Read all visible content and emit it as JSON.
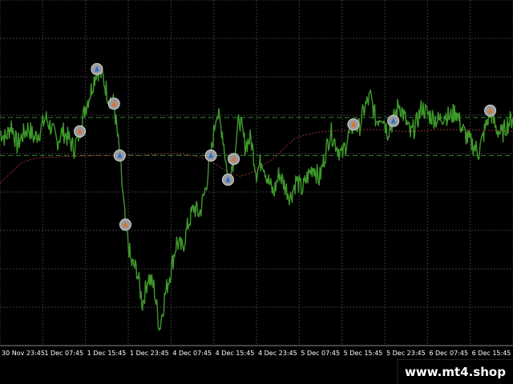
{
  "colors": {
    "background": "#000000",
    "grid": "#3a3a3a",
    "price_line": "#3f9a2b",
    "level_line": "#2f8a2f",
    "moving_average": "#a03030",
    "axis_text": "#ffffff"
  },
  "watermark": "www.mt4.shop",
  "chart_data": {
    "type": "line",
    "grid": true,
    "x_tick_labels": [
      "30 Nov 23:45",
      "1 Dec 07:45",
      "1 Dec 15:45",
      "1 Dec 23:45",
      "4 Dec 07:45",
      "4 Dec 15:45",
      "4 Dec 23:45",
      "5 Dec 07:45",
      "5 Dec 15:45",
      "5 Dec 23:45",
      "6 Dec 07:45",
      "6 Dec 15:45",
      "6 Dec"
    ],
    "series": [
      {
        "values": [
          0.62,
          0.6,
          0.64,
          0.58,
          0.61,
          0.63,
          0.6,
          0.62,
          0.66,
          0.63,
          0.59,
          0.62,
          0.6,
          0.57,
          0.62,
          0.69,
          0.74,
          0.8,
          0.78,
          0.72,
          0.7,
          0.55,
          0.35,
          0.24,
          0.22,
          0.12,
          0.2,
          0.17,
          0.05,
          0.15,
          0.22,
          0.3,
          0.28,
          0.35,
          0.4,
          0.38,
          0.45,
          0.55,
          0.68,
          0.62,
          0.48,
          0.54,
          0.66,
          0.58,
          0.6,
          0.5,
          0.54,
          0.48,
          0.44,
          0.5,
          0.46,
          0.43,
          0.48,
          0.45,
          0.49,
          0.52,
          0.48,
          0.55,
          0.62,
          0.58,
          0.55,
          0.6,
          0.64,
          0.63,
          0.69,
          0.72,
          0.65,
          0.67,
          0.62,
          0.65,
          0.7,
          0.66,
          0.61,
          0.64,
          0.69,
          0.67,
          0.66,
          0.65,
          0.67,
          0.66,
          0.68,
          0.63,
          0.6,
          0.58,
          0.56,
          0.62,
          0.68,
          0.63,
          0.61,
          0.64,
          0.66
        ]
      },
      {
        "values": [
          0.47,
          0.5,
          0.53,
          0.54,
          0.545,
          0.545,
          0.548,
          0.548,
          0.549,
          0.55,
          0.55,
          0.55,
          0.552,
          0.55,
          0.553,
          0.555,
          0.555,
          0.552,
          0.548,
          0.54,
          0.52,
          0.5,
          0.49,
          0.5,
          0.52,
          0.54,
          0.57,
          0.6,
          0.61,
          0.617,
          0.62,
          0.622,
          0.624,
          0.625,
          0.625,
          0.625,
          0.622,
          0.62,
          0.62,
          0.622,
          0.625,
          0.625,
          0.625,
          0.624,
          0.623,
          0.623,
          0.62,
          0.62
        ]
      }
    ],
    "levels": [
      0.66,
      0.55
    ]
  }
}
